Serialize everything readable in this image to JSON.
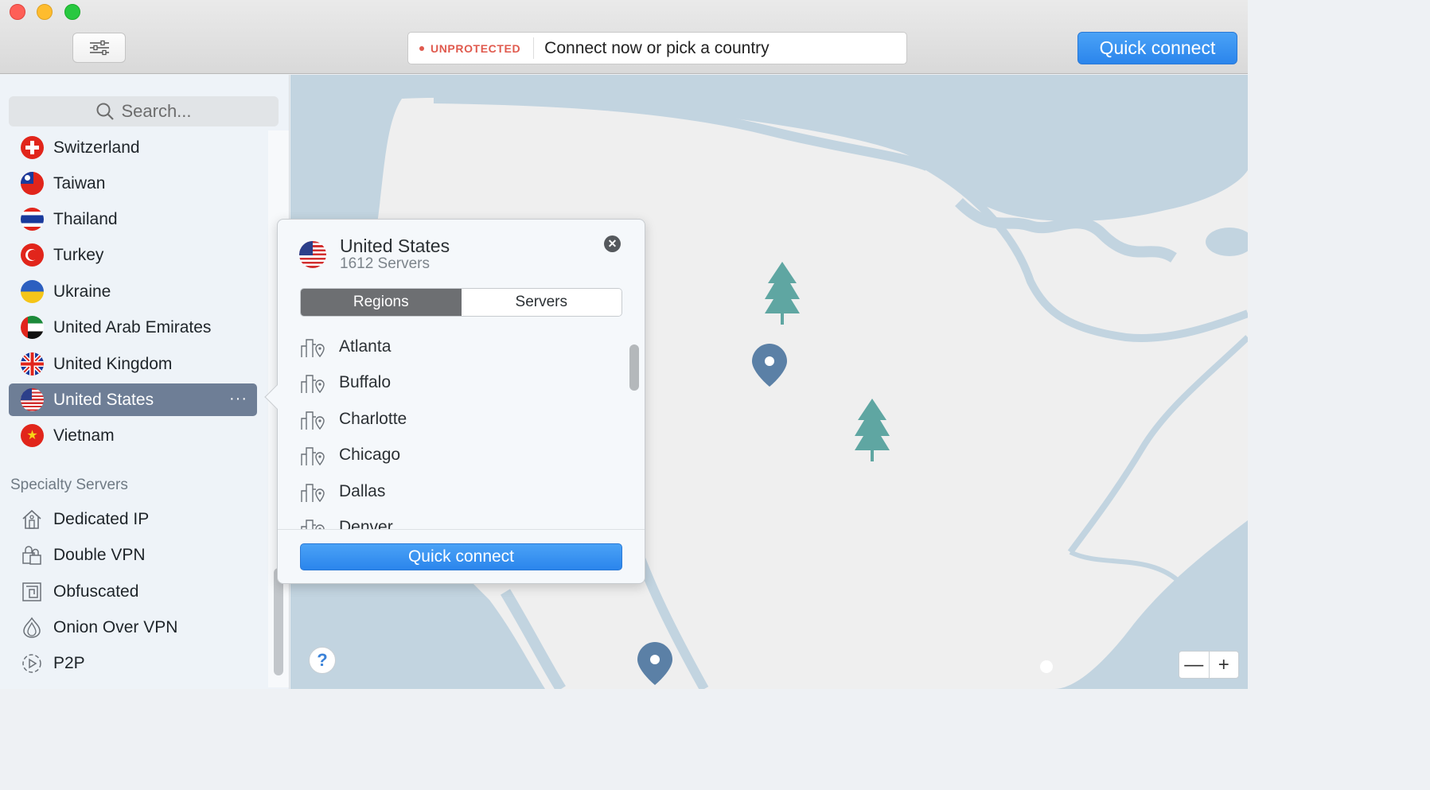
{
  "toolbar": {
    "status_label": "UNPROTECTED",
    "status_message": "Connect now or pick a country",
    "quick_connect_label": "Quick connect"
  },
  "sidebar": {
    "search_placeholder": "Search...",
    "countries": [
      {
        "name": "Switzerland",
        "flag": "switzerland-flag-icon"
      },
      {
        "name": "Taiwan",
        "flag": "taiwan-flag-icon"
      },
      {
        "name": "Thailand",
        "flag": "thailand-flag-icon"
      },
      {
        "name": "Turkey",
        "flag": "turkey-flag-icon"
      },
      {
        "name": "Ukraine",
        "flag": "ukraine-flag-icon"
      },
      {
        "name": "United Arab Emirates",
        "flag": "uae-flag-icon"
      },
      {
        "name": "United Kingdom",
        "flag": "uk-flag-icon"
      },
      {
        "name": "United States",
        "flag": "us-flag-icon",
        "selected": true,
        "more": "···"
      },
      {
        "name": "Vietnam",
        "flag": "vietnam-flag-icon"
      }
    ],
    "specialty_heading": "Specialty Servers",
    "specialty": [
      {
        "name": "Dedicated IP",
        "icon": "house-icon"
      },
      {
        "name": "Double VPN",
        "icon": "double-lock-icon"
      },
      {
        "name": "Obfuscated",
        "icon": "obfuscated-icon"
      },
      {
        "name": "Onion Over VPN",
        "icon": "onion-icon"
      },
      {
        "name": "P2P",
        "icon": "p2p-icon"
      }
    ]
  },
  "popover": {
    "country": "United States",
    "server_count": "1612 Servers",
    "tabs": [
      "Regions",
      "Servers"
    ],
    "active_tab": "Regions",
    "regions": [
      "Atlanta",
      "Buffalo",
      "Charlotte",
      "Chicago",
      "Dallas",
      "Denver"
    ],
    "quick_connect_label": "Quick connect"
  },
  "map": {
    "help_label": "?",
    "zoom_out": "—",
    "zoom_in": "+"
  },
  "colors": {
    "accent": "#2b85ec",
    "unprotected": "#e05a4e",
    "selected_row": "#6e7e96",
    "map_water": "#c2d4e0",
    "map_land": "#efefef",
    "tree": "#5fa6a2",
    "pin": "#5b80a6"
  }
}
